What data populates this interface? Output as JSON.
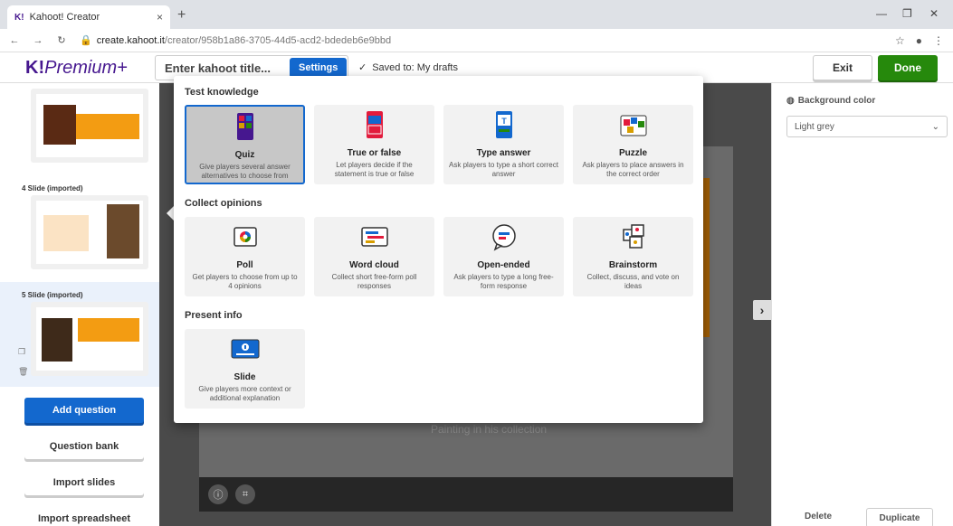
{
  "browser": {
    "tab_title": "Kahoot! Creator",
    "tab_favicon": "K!",
    "tab_close": "×",
    "new_tab": "+",
    "url_host": "create.kahoot.it",
    "url_path": "/creator/958b1a86-3705-44d5-acd2-bdedeb6e9bbd"
  },
  "header": {
    "logo_brand": "K!",
    "logo_text": "Premium+",
    "title_placeholder": "Enter kahoot title...",
    "settings_label": "Settings",
    "saved_text": "Saved to: My drafts",
    "exit_label": "Exit",
    "done_label": "Done"
  },
  "sidebar": {
    "slides": [
      {
        "label": ""
      },
      {
        "label": "4  Slide (imported)"
      },
      {
        "label": "5  Slide (imported)"
      }
    ],
    "buttons": {
      "add_question": "Add question",
      "question_bank": "Question bank",
      "import_slides": "Import slides",
      "import_spreadsheet": "Import spreadsheet"
    }
  },
  "main": {
    "caption": "Painting in his collection"
  },
  "right_panel": {
    "bg_label": "Background color",
    "bg_value": "Light grey",
    "delete_label": "Delete",
    "duplicate_label": "Duplicate"
  },
  "popup": {
    "sections": [
      {
        "title": "Test knowledge",
        "cards": [
          {
            "name": "Quiz",
            "desc": "Give players several answer alternatives to choose from"
          },
          {
            "name": "True or false",
            "desc": "Let players decide if the statement is true or false"
          },
          {
            "name": "Type answer",
            "desc": "Ask players to type a short correct answer"
          },
          {
            "name": "Puzzle",
            "desc": "Ask players to place answers in the correct order"
          }
        ]
      },
      {
        "title": "Collect opinions",
        "cards": [
          {
            "name": "Poll",
            "desc": "Get players to choose from up to 4 opinions"
          },
          {
            "name": "Word cloud",
            "desc": "Collect short free-form poll responses"
          },
          {
            "name": "Open-ended",
            "desc": "Ask players to type a long free-form response"
          },
          {
            "name": "Brainstorm",
            "desc": "Collect, discuss, and vote on ideas"
          }
        ]
      },
      {
        "title": "Present info",
        "cards": [
          {
            "name": "Slide",
            "desc": "Give players more context or additional explanation"
          }
        ]
      }
    ]
  },
  "colors": {
    "kahoot_purple": "#46178f",
    "blue": "#1368ce",
    "green": "#26890c",
    "red": "#e21b3c",
    "yellow": "#d89e00"
  }
}
